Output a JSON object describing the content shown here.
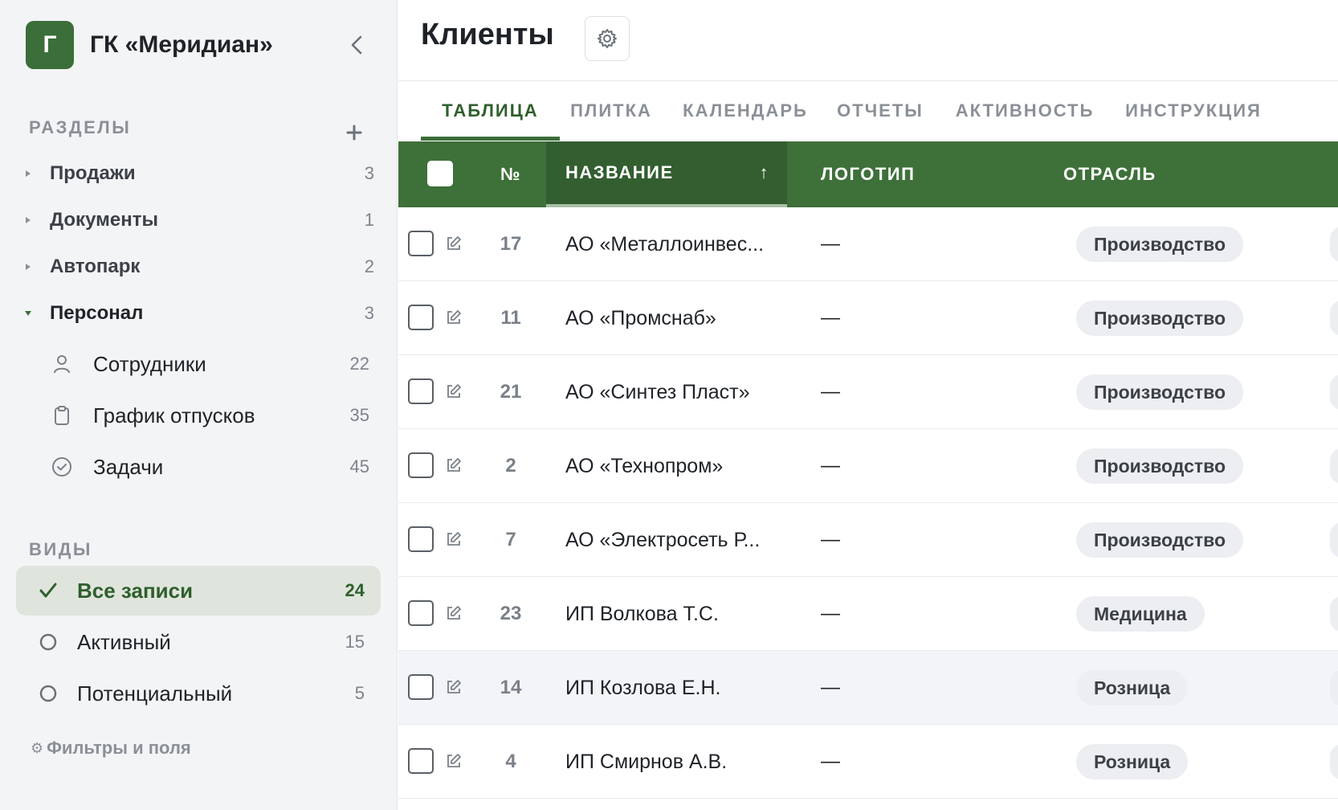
{
  "sidebar": {
    "brand": {
      "logo_letter": "Г",
      "name": "ГК «Меридиан»"
    },
    "sections_title": "РАЗДЕЛЫ",
    "sections": [
      {
        "label": "Продажи",
        "count": "3",
        "open": false
      },
      {
        "label": "Документы",
        "count": "1",
        "open": false
      },
      {
        "label": "Автопарк",
        "count": "2",
        "open": false
      },
      {
        "label": "Персонал",
        "count": "3",
        "open": true
      }
    ],
    "subitems": [
      {
        "icon": "person-icon",
        "label": "Сотрудники",
        "count": "22"
      },
      {
        "icon": "clipboard-icon",
        "label": "График отпусков",
        "count": "35"
      },
      {
        "icon": "check-circle-icon",
        "label": "Задачи",
        "count": "45"
      }
    ],
    "views_title": "ВИДЫ",
    "views": [
      {
        "label": "Все записи",
        "count": "24",
        "active": true
      },
      {
        "label": "Активный",
        "count": "15",
        "active": false
      },
      {
        "label": "Потенциальный",
        "count": "5",
        "active": false
      }
    ],
    "filters_label": "Фильтры и поля"
  },
  "main": {
    "title": "Клиенты",
    "tabs": [
      {
        "label": "ТАБЛИЦА",
        "active": true
      },
      {
        "label": "ПЛИТКА",
        "active": false
      },
      {
        "label": "КАЛЕНДАРЬ",
        "active": false
      },
      {
        "label": "ОТЧЕТЫ",
        "active": false
      },
      {
        "label": "АКТИВНОСТЬ",
        "active": false
      },
      {
        "label": "ИНСТРУКЦИЯ",
        "active": false
      }
    ],
    "table": {
      "columns": {
        "num": "№",
        "name": "НАЗВАНИЕ",
        "sort_arrow": "↑",
        "logo": "ЛОГОТИП",
        "industry": "ОТРАСЛЬ"
      },
      "rows": [
        {
          "num": "17",
          "name": "АО «Металлоинвес...",
          "logo": "—",
          "industry": "Производство"
        },
        {
          "num": "11",
          "name": "АО «Промснаб»",
          "logo": "—",
          "industry": "Производство"
        },
        {
          "num": "21",
          "name": "АО «Синтез Пласт»",
          "logo": "—",
          "industry": "Производство"
        },
        {
          "num": "2",
          "name": "АО «Технопром»",
          "logo": "—",
          "industry": "Производство"
        },
        {
          "num": "7",
          "name": "АО «Электросеть Р...",
          "logo": "—",
          "industry": "Производство"
        },
        {
          "num": "23",
          "name": "ИП Волкова Т.С.",
          "logo": "—",
          "industry": "Медицина"
        },
        {
          "num": "14",
          "name": "ИП Козлова Е.Н.",
          "logo": "—",
          "industry": "Розница",
          "hover": true
        },
        {
          "num": "4",
          "name": "ИП Смирнов А.В.",
          "logo": "—",
          "industry": "Розница"
        }
      ]
    }
  },
  "colors": {
    "accent": "#3e7039",
    "accent_dark": "#335e30",
    "sidebar_bg": "#f3f4f6",
    "active_view_bg": "#dfe5dd"
  }
}
